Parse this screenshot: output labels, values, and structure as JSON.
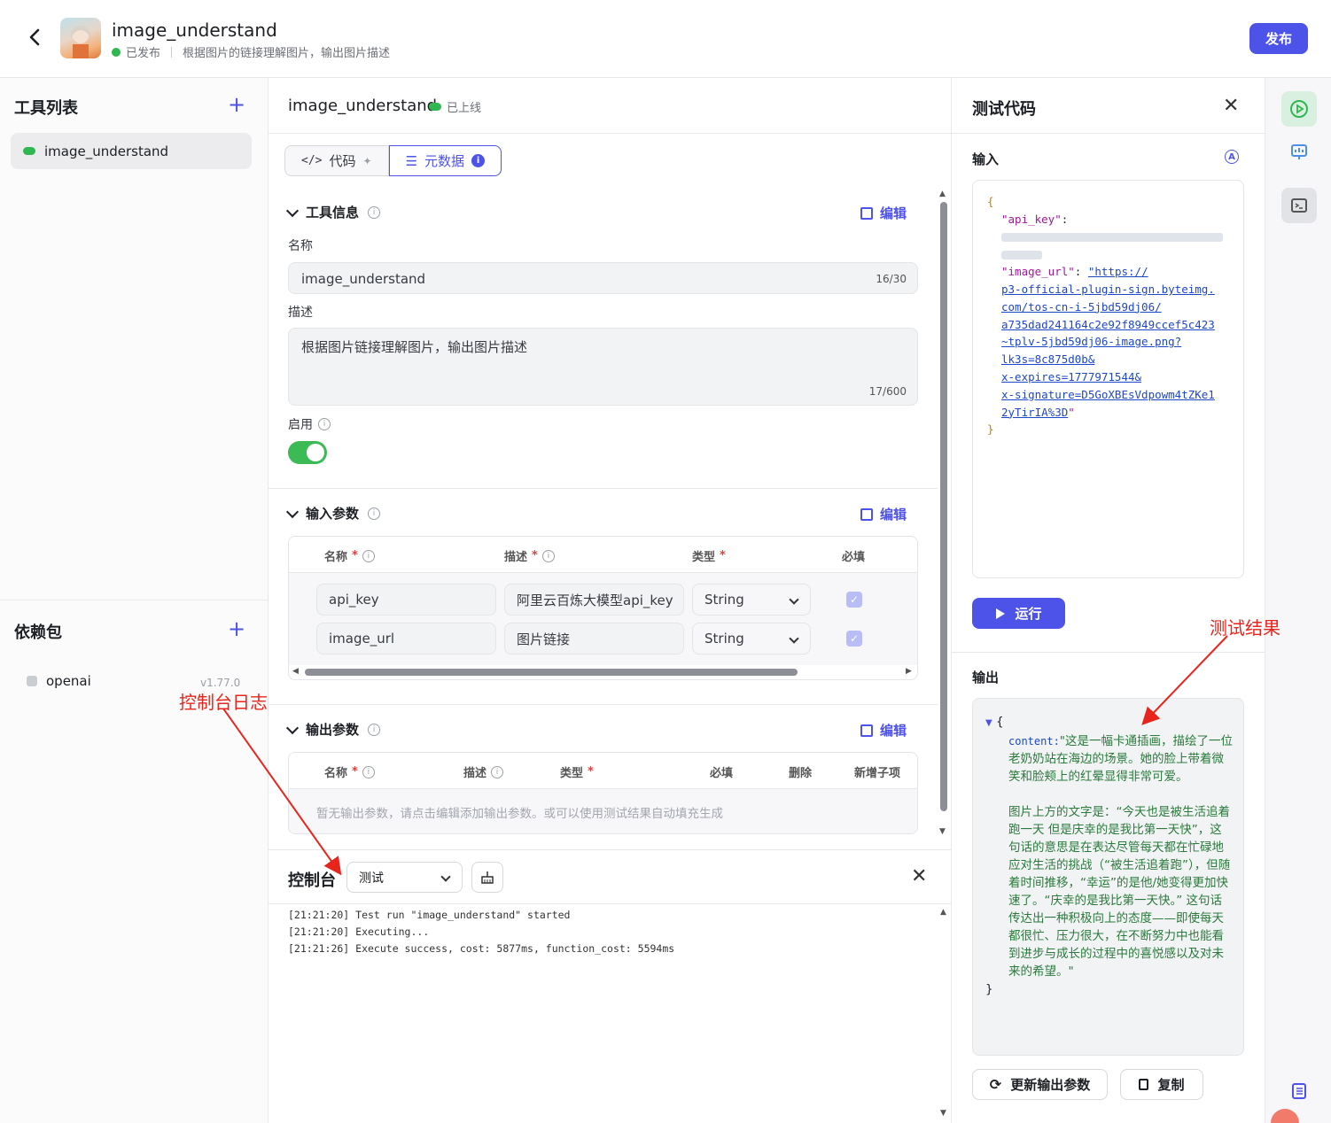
{
  "header": {
    "title": "image_understand",
    "status": "已发布",
    "description": "根据图片的链接理解图片，输出图片描述",
    "publish_label": "发布"
  },
  "sidebar": {
    "tools_heading": "工具列表",
    "tools": [
      {
        "label": "image_understand"
      }
    ],
    "deps_heading": "依赖包",
    "deps": [
      {
        "name": "openai",
        "version": "v1.77.0"
      }
    ]
  },
  "center": {
    "title": "image_understand",
    "status": "已上线",
    "tabs": [
      {
        "label": "代码"
      },
      {
        "label": "元数据"
      }
    ],
    "tool_info": {
      "heading": "工具信息",
      "edit": "编辑",
      "name_label": "名称",
      "name_value": "image_understand",
      "name_count": "16/30",
      "desc_label": "描述",
      "desc_value": "根据图片链接理解图片，输出图片描述",
      "desc_count": "17/600",
      "enable_label": "启用",
      "enabled": true
    },
    "input_params": {
      "heading": "输入参数",
      "edit": "编辑",
      "columns": [
        "名称",
        "描述",
        "类型",
        "必填"
      ],
      "rows": [
        {
          "name": "api_key",
          "desc": "阿里云百炼大模型api_key",
          "type": "String",
          "required": true
        },
        {
          "name": "image_url",
          "desc": "图片链接",
          "type": "String",
          "required": true
        }
      ]
    },
    "output_params": {
      "heading": "输出参数",
      "edit": "编辑",
      "columns": [
        "名称",
        "描述",
        "类型",
        "必填",
        "删除",
        "新增子项"
      ],
      "empty": "暂无输出参数，请点击编辑添加输出参数。或可以使用测试结果自动填充生成"
    }
  },
  "console": {
    "title": "控制台",
    "select": "测试",
    "logs": [
      "[21:21:20] Test run \"image_understand\" started",
      "[21:21:20] Executing...",
      "[21:21:26] Execute success, cost: 5877ms, function_cost: 5594ms"
    ]
  },
  "test": {
    "title": "测试代码",
    "input_label": "输入",
    "input_json": {
      "open": "{",
      "k1": "\"api_key\"",
      "k2": "\"image_url\"",
      "colon": ": ",
      "url_lines": [
        "\"https://",
        "p3-official-plugin-sign.byteimg.",
        "com/tos-cn-i-5jbd59dj06/",
        "a735dad241164c2e92f8949ccef5c423",
        "~tplv-5jbd59dj06-image.png?",
        "lk3s=8c875d0b&",
        "x-expires=1777971544&",
        "x-signature=D5GoXBEsVdpowm4tZKe1",
        "2yTirIA%3D"
      ],
      "url_end": "\"",
      "close": "}"
    },
    "run_label": "运行",
    "output_label": "输出",
    "output": {
      "open": "{",
      "key": "content:",
      "value": "\"这是一幅卡通插画，描绘了一位老奶奶站在海边的场景。她的脸上带着微笑和脸颊上的红晕显得非常可爱。\n\n图片上方的文字是：“今天也是被生活追着跑一天 但是庆幸的是我比第一天快”，这句话的意思是在表达尽管每天都在忙碌地应对生活的挑战（“被生活追着跑”），但随着时间推移，“幸运”的是他/她变得更加快速了。“庆幸的是我比第一天快。” 这句话传达出一种积极向上的态度——即使每天都很忙、压力很大，在不断努力中也能看到进步与成长的过程中的喜悦感以及对未来的希望。\"",
      "close": "}"
    },
    "update_btn": "更新输出参数",
    "copy_btn": "复制"
  },
  "annotations": {
    "result": "测试结果",
    "console": "控制台日志"
  },
  "colors": {
    "accent": "#4d53e8",
    "success": "#2fb751",
    "annotation": "#e8251d"
  }
}
